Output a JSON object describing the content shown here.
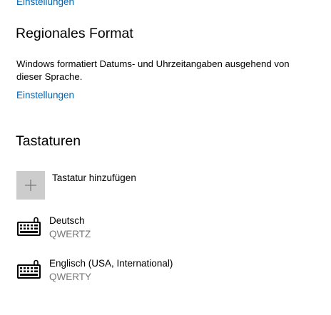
{
  "top_link": {
    "label": "Einstellungen"
  },
  "regional": {
    "title": "Regionales Format",
    "description": "Windows formatiert Datums- und Uhrzeitangaben ausgehend von dieser Sprache.",
    "settings_link": "Einstellungen"
  },
  "keyboards": {
    "title": "Tastaturen",
    "add_label": "Tastatur hinzufügen",
    "add_icon": "plus-icon",
    "items": [
      {
        "name": "Deutsch",
        "layout": "QWERTZ",
        "icon": "keyboard-icon"
      },
      {
        "name": "Englisch (USA, International)",
        "layout": "QWERTY",
        "icon": "keyboard-icon"
      }
    ]
  },
  "colors": {
    "link": "#0063b1",
    "tile": "#cccccc",
    "secondary_text": "#767676",
    "background": "#ffffff"
  }
}
